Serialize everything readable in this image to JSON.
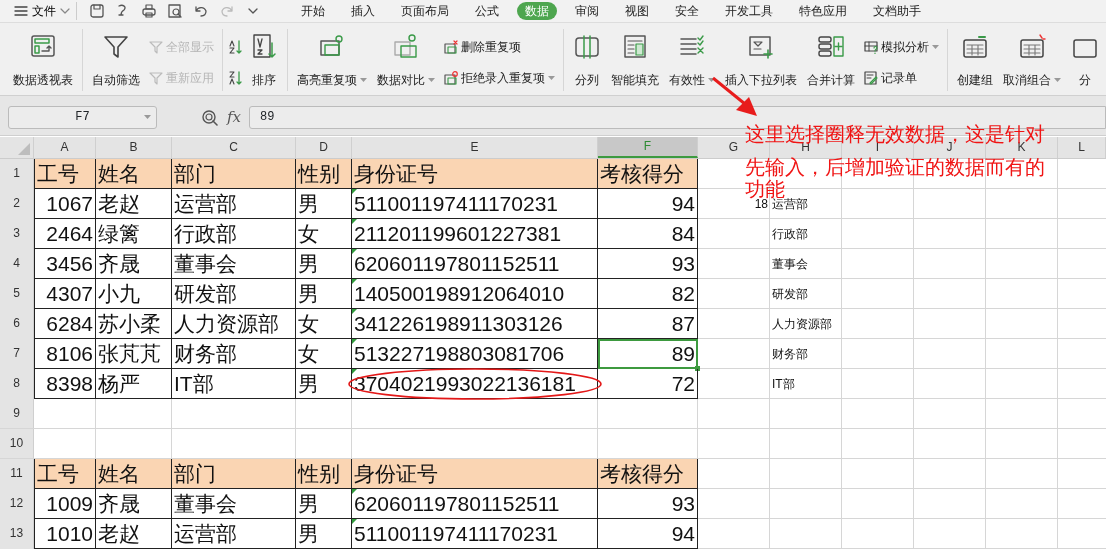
{
  "menu": {
    "file_label": "文件"
  },
  "tabs": [
    {
      "label": "开始",
      "selected": false
    },
    {
      "label": "插入",
      "selected": false
    },
    {
      "label": "页面布局",
      "selected": false
    },
    {
      "label": "公式",
      "selected": false
    },
    {
      "label": "数据",
      "selected": true
    },
    {
      "label": "审阅",
      "selected": false
    },
    {
      "label": "视图",
      "selected": false
    },
    {
      "label": "安全",
      "selected": false
    },
    {
      "label": "开发工具",
      "selected": false
    },
    {
      "label": "特色应用",
      "selected": false
    },
    {
      "label": "文档助手",
      "selected": false
    }
  ],
  "ribbon": [
    {
      "items": [
        {
          "kind": "large",
          "label": "数据透视表",
          "dropdown": false
        }
      ]
    },
    {
      "items": [
        {
          "kind": "large",
          "label": "自动筛选",
          "dropdown": false
        },
        {
          "kind": "stack",
          "entries": [
            {
              "label": "全部显示",
              "disabled": true,
              "dropdown": false
            },
            {
              "label": "重新应用",
              "disabled": true,
              "dropdown": false
            }
          ]
        }
      ]
    },
    {
      "items": [
        {
          "kind": "stack",
          "entries": [
            {
              "disabled": false
            },
            {
              "disabled": false
            }
          ]
        },
        {
          "kind": "large",
          "label": "排序",
          "dropdown": false
        }
      ]
    },
    {
      "items": [
        {
          "kind": "large",
          "label": "高亮重复项",
          "dropdown": true
        },
        {
          "kind": "large",
          "label": "数据对比",
          "dropdown": true
        },
        {
          "kind": "stack",
          "entries": [
            {
              "label": "删除重复项",
              "disabled": false,
              "dropdown": false
            },
            {
              "label": "拒绝录入重复项",
              "disabled": false,
              "dropdown": true
            }
          ]
        }
      ]
    },
    {
      "items": [
        {
          "kind": "large",
          "label": "分列",
          "dropdown": false
        },
        {
          "kind": "large",
          "label": "智能填充",
          "dropdown": false
        },
        {
          "kind": "large",
          "label": "有效性",
          "dropdown": true
        },
        {
          "kind": "large",
          "label": "插入下拉列表",
          "dropdown": false
        },
        {
          "kind": "large",
          "label": "合并计算",
          "dropdown": false
        },
        {
          "kind": "stack",
          "entries": [
            {
              "label": "模拟分析",
              "disabled": false,
              "dropdown": true
            },
            {
              "label": "记录单",
              "disabled": false,
              "dropdown": false
            }
          ]
        }
      ]
    },
    {
      "items": [
        {
          "kind": "large",
          "label": "创建组",
          "dropdown": false
        },
        {
          "kind": "large",
          "label": "取消组合",
          "dropdown": true
        },
        {
          "kind": "large",
          "label": "分",
          "dropdown": false
        }
      ]
    }
  ],
  "formula_bar": {
    "cell_ref": "F7",
    "function_label": "fx",
    "value": "89"
  },
  "columns": [
    {
      "label": "A",
      "selected": false
    },
    {
      "label": "B",
      "selected": false
    },
    {
      "label": "C",
      "selected": false
    },
    {
      "label": "D",
      "selected": false
    },
    {
      "label": "E",
      "selected": false
    },
    {
      "label": "F",
      "selected": true
    },
    {
      "label": "G",
      "selected": false
    },
    {
      "label": "H",
      "selected": false
    },
    {
      "label": "I",
      "selected": false
    },
    {
      "label": "J",
      "selected": false
    },
    {
      "label": "K",
      "selected": false
    },
    {
      "label": "L",
      "selected": false
    }
  ],
  "rows": [
    {
      "number": "1",
      "kind": "header",
      "cells": [
        "工号",
        "姓名",
        "部门",
        "性别",
        "身份证号",
        "考核得分"
      ],
      "selected_score": false,
      "circled": false
    },
    {
      "number": "2",
      "kind": "data",
      "cells": [
        "1067",
        "老赵",
        "运营部",
        "男",
        "511001197411170231",
        "94"
      ],
      "column_g": "18",
      "column_h": "运营部",
      "selected_score": false,
      "circled": false
    },
    {
      "number": "3",
      "kind": "data",
      "cells": [
        "2464",
        "绿篱",
        "行政部",
        "女",
        "211201199601227381",
        "84"
      ],
      "column_h": "行政部",
      "selected_score": false,
      "circled": false
    },
    {
      "number": "4",
      "kind": "data",
      "cells": [
        "3456",
        "齐晟",
        "董事会",
        "男",
        "620601197801152511",
        "93"
      ],
      "column_h": "董事会",
      "selected_score": false,
      "circled": false
    },
    {
      "number": "5",
      "kind": "data",
      "cells": [
        "4307",
        "小九",
        "研发部",
        "男",
        "140500198912064010",
        "82"
      ],
      "column_h": "研发部",
      "selected_score": false,
      "circled": false
    },
    {
      "number": "6",
      "kind": "data",
      "cells": [
        "6284",
        "苏小柔",
        "人力资源部",
        "女",
        "341226198911303126",
        "87"
      ],
      "column_h": "人力资源部",
      "selected_score": false,
      "circled": false
    },
    {
      "number": "7",
      "kind": "data",
      "cells": [
        "8106",
        "张芃芃",
        "财务部",
        "女",
        "513227198803081706",
        "89"
      ],
      "column_h": "财务部",
      "selected_score": true,
      "circled": false
    },
    {
      "number": "8",
      "kind": "data",
      "cells": [
        "8398",
        "杨严",
        "IT部",
        "男",
        "3704021993022136181",
        "72"
      ],
      "column_h": "IT部",
      "selected_score": false,
      "circled": true
    },
    {
      "number": "9",
      "kind": "empty"
    },
    {
      "number": "10",
      "kind": "empty"
    },
    {
      "number": "11",
      "kind": "header",
      "cells": [
        "工号",
        "姓名",
        "部门",
        "性别",
        "身份证号",
        "考核得分"
      ],
      "selected_score": false,
      "circled": false
    },
    {
      "number": "12",
      "kind": "data",
      "cells": [
        "1009",
        "齐晟",
        "董事会",
        "男",
        "620601197801152511",
        "93"
      ],
      "selected_score": false,
      "circled": false
    },
    {
      "number": "13",
      "kind": "data",
      "cells": [
        "1010",
        "老赵",
        "运营部",
        "男",
        "511001197411170231",
        "94"
      ],
      "selected_score": false,
      "circled": false
    }
  ],
  "annotation": {
    "lines": [
      "这里选择圈释无效数据，这是针对",
      "先输入，后增加验证的数据而有的",
      "功能"
    ]
  }
}
